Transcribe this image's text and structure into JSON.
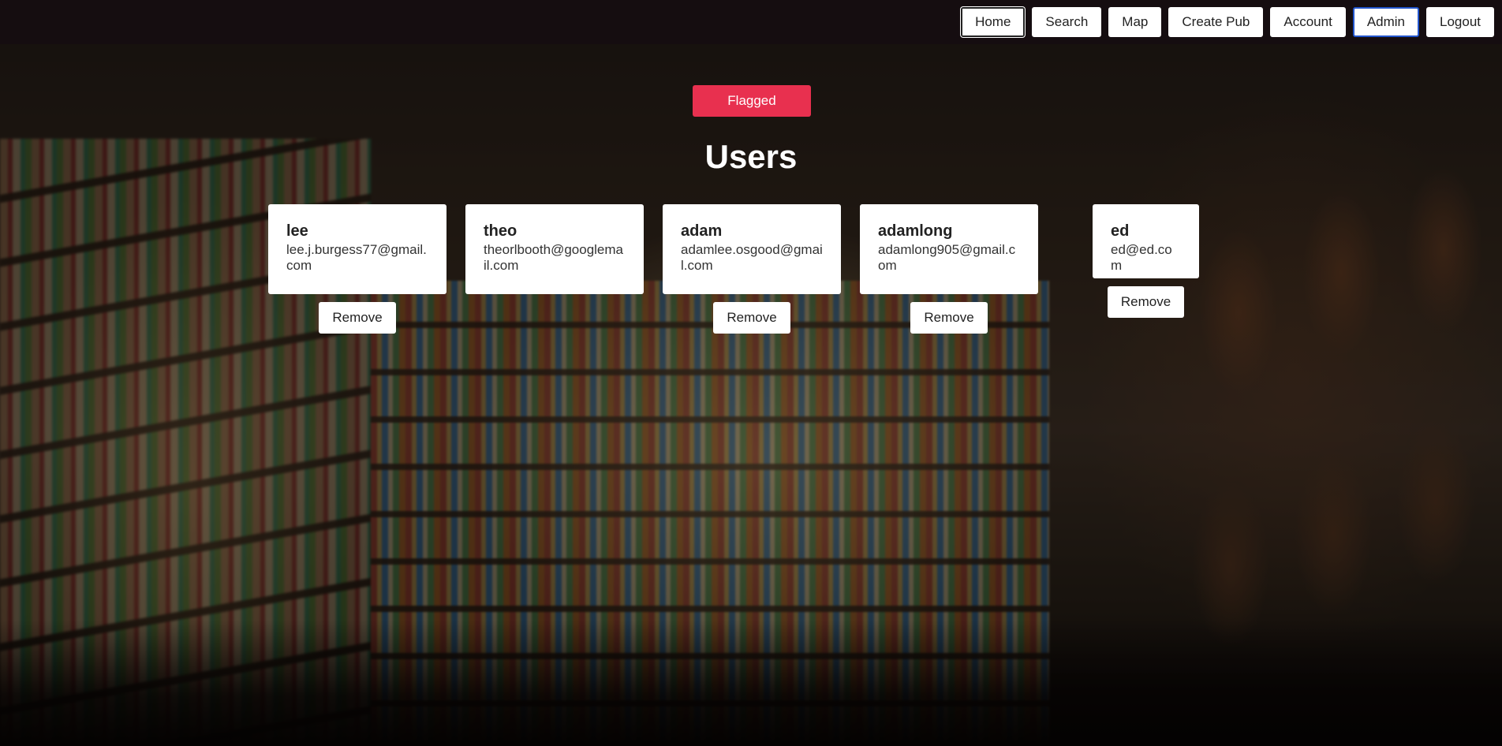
{
  "nav": {
    "items": [
      {
        "label": "Home",
        "name": "nav-home-button",
        "state": "active"
      },
      {
        "label": "Search",
        "name": "nav-search-button",
        "state": ""
      },
      {
        "label": "Map",
        "name": "nav-map-button",
        "state": ""
      },
      {
        "label": "Create Pub",
        "name": "nav-create-pub-button",
        "state": ""
      },
      {
        "label": "Account",
        "name": "nav-account-button",
        "state": ""
      },
      {
        "label": "Admin",
        "name": "nav-admin-button",
        "state": "focused"
      },
      {
        "label": "Logout",
        "name": "nav-logout-button",
        "state": ""
      }
    ]
  },
  "main": {
    "flagged_label": "Flagged",
    "title": "Users"
  },
  "users": [
    {
      "name": "lee",
      "email": "lee.j.burgess77@gmail.com",
      "remove_label": "Remove",
      "has_remove": true
    },
    {
      "name": "theo",
      "email": "theorlbooth@googlemail.com",
      "remove_label": "",
      "has_remove": false
    },
    {
      "name": "adam",
      "email": "adamlee.osgood@gmail.com",
      "remove_label": "Remove",
      "has_remove": true
    },
    {
      "name": "adamlong",
      "email": "adamlong905@gmail.com",
      "remove_label": "Remove",
      "has_remove": true
    },
    {
      "name": "ed",
      "email": "ed@ed.com",
      "remove_label": "Remove",
      "has_remove": true
    }
  ],
  "colors": {
    "navbar_bg": "#150d10",
    "flagged_bg": "#e8304f",
    "card_bg": "#ffffff",
    "title_text": "#ffffff"
  }
}
